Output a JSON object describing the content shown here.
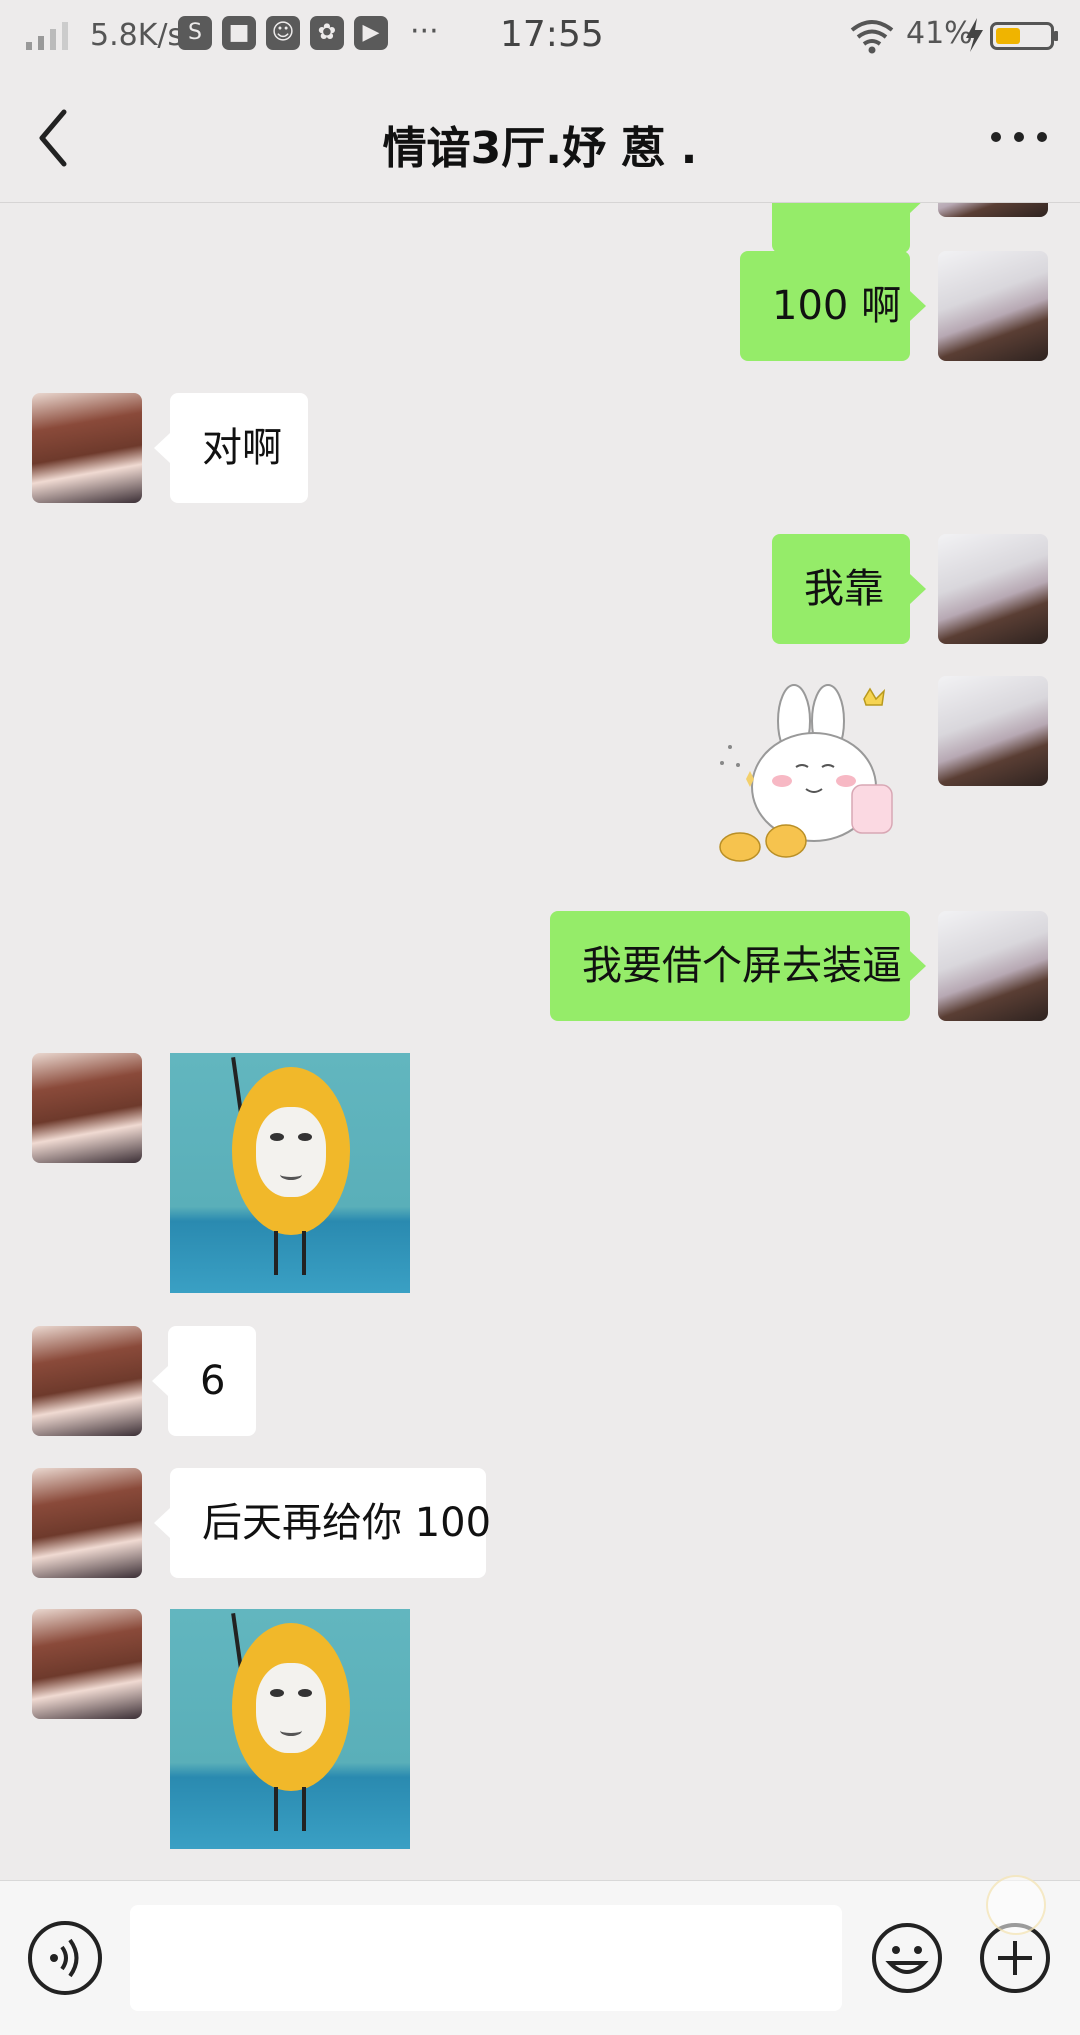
{
  "status_bar": {
    "network_speed": "5.8K/s",
    "time": "17:55",
    "battery": "41%",
    "overflow": "···",
    "app_icons": [
      "S",
      "■",
      "☺",
      "✿",
      "▶"
    ]
  },
  "header": {
    "title": "情谙3厅.妤 蒽 ."
  },
  "messages": [
    {
      "from": "me",
      "type": "text",
      "text": "100 啊"
    },
    {
      "from": "her",
      "type": "text",
      "text": "对啊"
    },
    {
      "from": "me",
      "type": "text",
      "text": "我靠"
    },
    {
      "from": "me",
      "type": "sticker",
      "sticker": "rabbit-sticker"
    },
    {
      "from": "me",
      "type": "text",
      "text": "我要借个屏去装逼"
    },
    {
      "from": "her",
      "type": "sticker",
      "sticker": "lemon-sticker"
    },
    {
      "from": "her",
      "type": "text",
      "text": "6"
    },
    {
      "from": "her",
      "type": "text",
      "text": "后天再给你 100"
    },
    {
      "from": "her",
      "type": "sticker",
      "sticker": "lemon-sticker"
    }
  ],
  "input_bar": {
    "placeholder": ""
  },
  "colors": {
    "background": "#edebeb",
    "outgoing_bubble": "#95ec69",
    "incoming_bubble": "#ffffff",
    "battery_fill": "#f0b400"
  }
}
